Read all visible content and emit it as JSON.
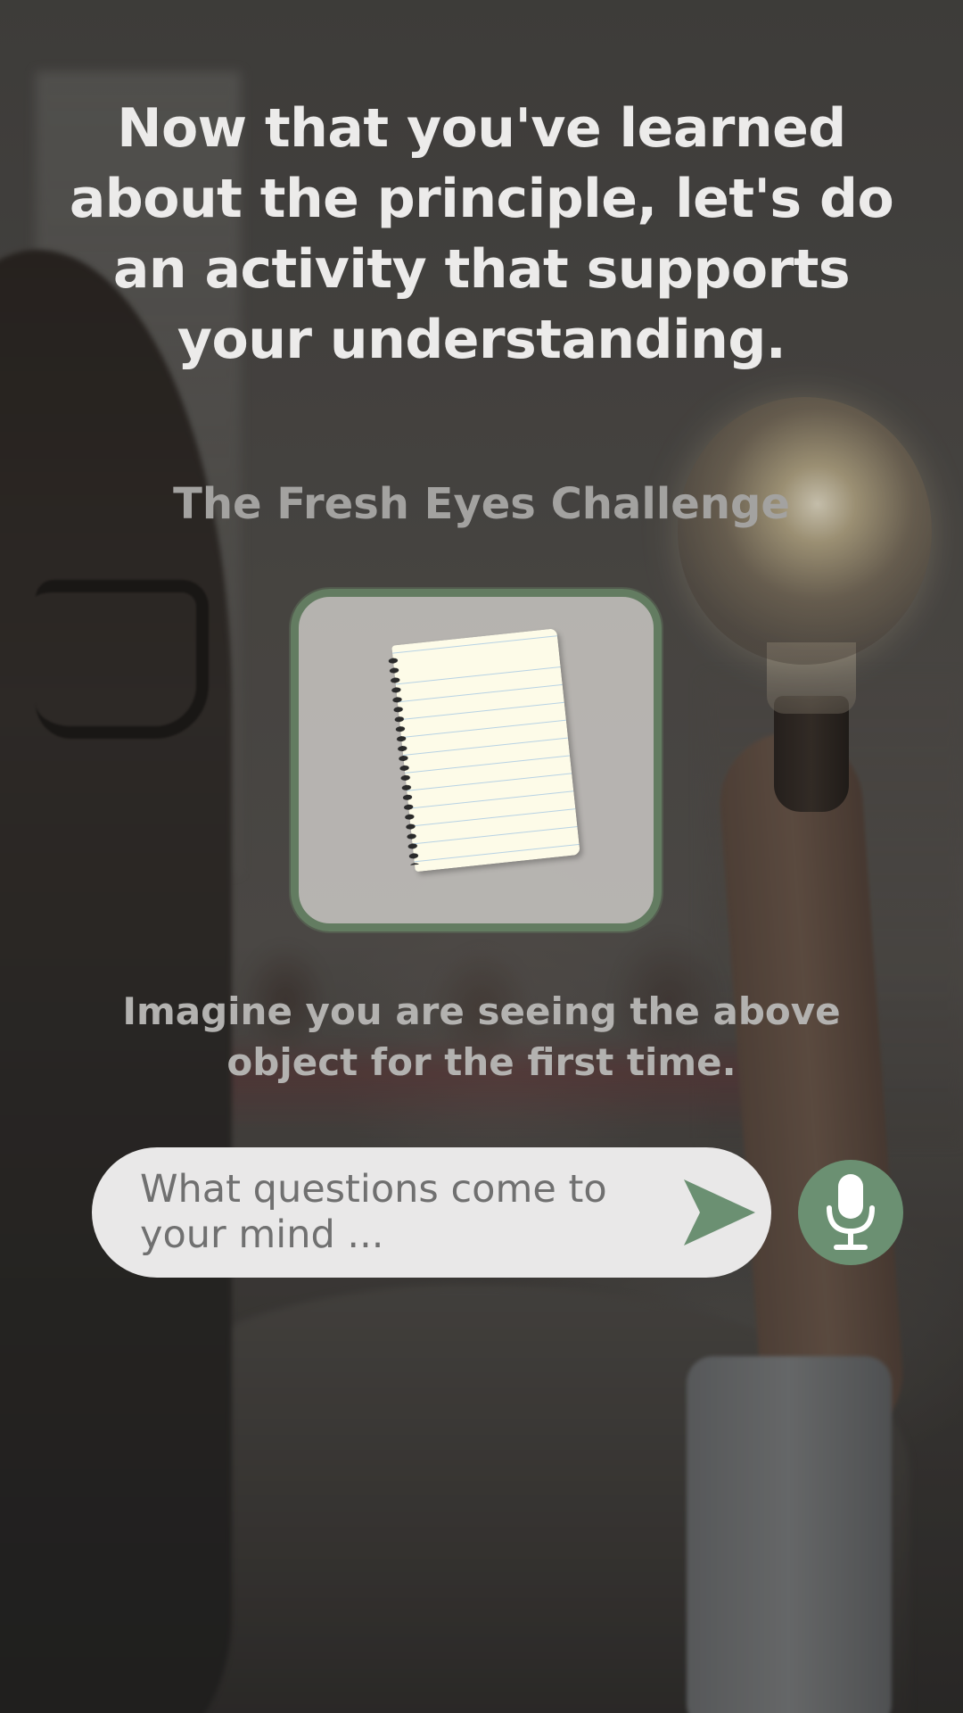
{
  "screen": {
    "headline": "Now that you've learned about the principle, let's do an activity that supports your understanding.",
    "activity_title": "The Fresh Eyes Challenge",
    "object_card": {
      "icon": "notepad-icon"
    },
    "prompt": "Imagine you are seeing the above object for the first time.",
    "answer_input": {
      "placeholder": "What questions come to your mind ...",
      "value": ""
    },
    "send_button": {
      "icon": "send-arrow-icon"
    },
    "mic_button": {
      "icon": "microphone-icon"
    }
  },
  "colors": {
    "accent_green": "#6b9072",
    "card_border": "#637c61",
    "headline_text": "#ecebea",
    "input_background": "#e9e8e8"
  }
}
